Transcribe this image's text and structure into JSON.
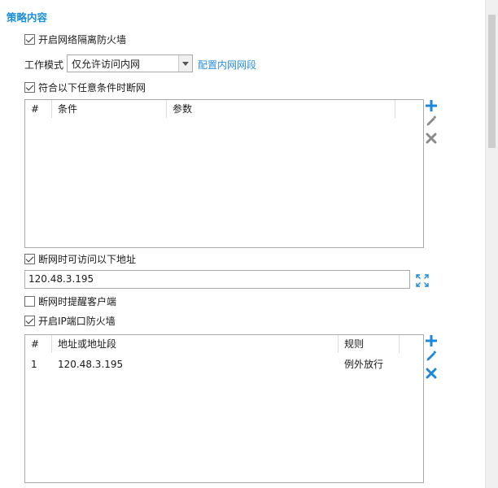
{
  "section": {
    "title": "策略内容"
  },
  "firewall": {
    "label": "开启网络隔离防火墙",
    "checked": true
  },
  "work_mode": {
    "label": "工作模式",
    "selected": "仅允许访问内网",
    "config_link": "配置内网网段"
  },
  "disconnect_conditions": {
    "label": "符合以下任意条件时断网",
    "checked": true,
    "columns": [
      "#",
      "条件",
      "参数"
    ],
    "rows": [],
    "actions": [
      "add-icon",
      "edit-icon",
      "delete-icon"
    ]
  },
  "allow_addresses": {
    "label": "断网时可访问以下地址",
    "checked": true,
    "value": "120.48.3.195"
  },
  "remind_client": {
    "label": "断网时提醒客户端",
    "checked": false
  },
  "ip_port_firewall": {
    "label": "开启IP端口防火墙",
    "checked": true,
    "columns": [
      "#",
      "地址或地址段",
      "规则"
    ],
    "rows": [
      {
        "index": "1",
        "address": "120.48.3.195",
        "rule": "例外放行"
      }
    ],
    "actions": [
      "add-icon",
      "edit-icon",
      "delete-icon"
    ]
  },
  "colors": {
    "accent": "#1a8fd6",
    "link": "#2a8ee0",
    "icon": "#1e88d8",
    "icon_disabled": "#8a8a8a"
  }
}
